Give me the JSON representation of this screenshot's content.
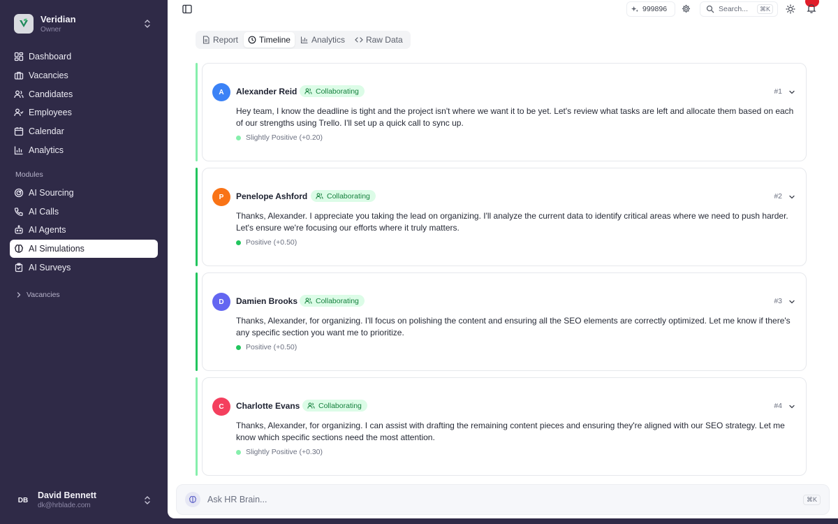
{
  "brand": {
    "name": "Veridian",
    "role": "Owner"
  },
  "nav": {
    "main": [
      {
        "label": "Dashboard",
        "icon": "dashboard-icon"
      },
      {
        "label": "Vacancies",
        "icon": "briefcase-icon"
      },
      {
        "label": "Candidates",
        "icon": "users-icon"
      },
      {
        "label": "Employees",
        "icon": "user-check-icon"
      },
      {
        "label": "Calendar",
        "icon": "calendar-icon"
      },
      {
        "label": "Analytics",
        "icon": "bar-chart-icon"
      }
    ],
    "modules_label": "Modules",
    "modules": [
      {
        "label": "AI Sourcing",
        "icon": "radar-icon"
      },
      {
        "label": "AI Calls",
        "icon": "phone-icon"
      },
      {
        "label": "AI Agents",
        "icon": "bot-icon"
      },
      {
        "label": "AI Simulations",
        "icon": "brain-icon",
        "active": true
      },
      {
        "label": "AI Surveys",
        "icon": "clipboard-icon"
      }
    ],
    "vacancies_label": "Vacancies"
  },
  "user": {
    "initials": "DB",
    "name": "David Bennett",
    "email": "dk@hrblade.com"
  },
  "topbar": {
    "credits": "999896",
    "search_placeholder": "Search...",
    "search_kbd": "⌘K"
  },
  "tabs": [
    {
      "label": "Report",
      "icon": "file-text-icon"
    },
    {
      "label": "Timeline",
      "icon": "clock-icon",
      "active": true
    },
    {
      "label": "Analytics",
      "icon": "bar-chart-icon"
    },
    {
      "label": "Raw Data",
      "icon": "code-icon"
    }
  ],
  "entries": [
    {
      "initial": "A",
      "name": "Alexander Reid",
      "status": "Collaborating",
      "number": "#1",
      "avatar_color": "#3b82f6",
      "bar_color": "#86efac",
      "dot_color": "#86efac",
      "message": "Hey team, I know the deadline is tight and the project isn't where we want it to be yet. Let's review what tasks are left and allocate them based on each of our strengths using Trello. I'll set up a quick call to sync up.",
      "sentiment": "Slightly Positive (+0.20)"
    },
    {
      "initial": "P",
      "name": "Penelope Ashford",
      "status": "Collaborating",
      "number": "#2",
      "avatar_color": "#f97316",
      "bar_color": "#22c55e",
      "dot_color": "#22c55e",
      "message": "Thanks, Alexander. I appreciate you taking the lead on organizing. I'll analyze the current data to identify critical areas where we need to push harder. Let's ensure we're focusing our efforts where it truly matters.",
      "sentiment": "Positive (+0.50)"
    },
    {
      "initial": "D",
      "name": "Damien Brooks",
      "status": "Collaborating",
      "number": "#3",
      "avatar_color": "#6366f1",
      "bar_color": "#22c55e",
      "dot_color": "#22c55e",
      "message": "Thanks, Alexander, for organizing. I'll focus on polishing the content and ensuring all the SEO elements are correctly optimized. Let me know if there's any specific section you want me to prioritize.",
      "sentiment": "Positive (+0.50)"
    },
    {
      "initial": "C",
      "name": "Charlotte Evans",
      "status": "Collaborating",
      "number": "#4",
      "avatar_color": "#f43f5e",
      "bar_color": "#86efac",
      "dot_color": "#86efac",
      "message": "Thanks, Alexander, for organizing. I can assist with drafting the remaining content pieces and ensuring they're aligned with our SEO strategy. Let me know which specific sections need the most attention.",
      "sentiment": "Slightly Positive (+0.30)"
    }
  ],
  "assistant": {
    "placeholder": "Ask HR Brain...",
    "kbd": "⌘K"
  }
}
